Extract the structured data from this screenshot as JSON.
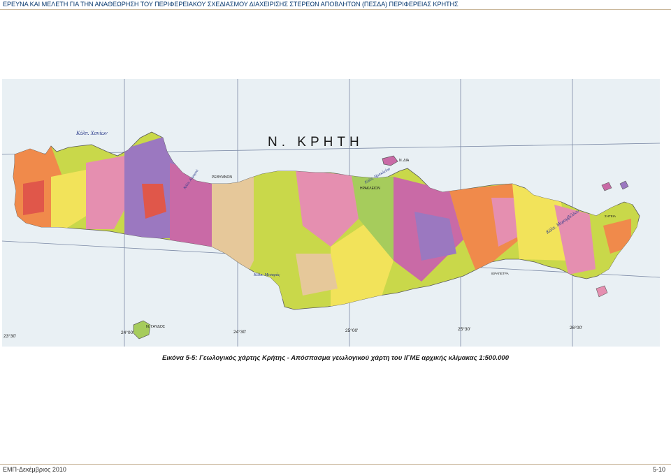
{
  "header": {
    "title": "ΕΡΕΥΝΑ ΚΑΙ ΜΕΛΕΤΗ ΓΙΑ ΤΗΝ ΑΝΑΘΕΩΡΗΣΗ ΤΟΥ ΠΕΡΙΦΕΡΕΙΑΚΟΥ ΣΧΕΔΙΑΣΜΟΥ ΔΙΑΧΕΙΡΙΣΗΣ ΣΤΕΡΕΩΝ ΑΠΟΒΛΗΤΩΝ (ΠΕΣΔΑ) ΠΕΡΙΦΕΡΕΙΑΣ ΚΡΗΤΗΣ"
  },
  "map": {
    "island_title": "Ν. ΚΡΗΤΗ",
    "longitude_labels": [
      "23°30'",
      "24°00'",
      "24°30'",
      "25°00'",
      "25°30'",
      "26°00'"
    ],
    "islands": [
      "Ν. ΓΑΥΔΟΣ",
      "Ν. ΔΙΑ"
    ],
    "gulfs": [
      "Κόλπ. Χανίων",
      "Κόλπ. Ηρακλείου",
      "Κόλπ. Μεσαράς",
      "Κόλπ. Μεραμβέλλου",
      "Κόλπ. Αλμυρού"
    ],
    "towns": [
      "ΡΕΘΥΜΝΟΝ",
      "ΗΡΑΚΛΕΙΟΝ",
      "ΙΕΡΑΠΕΤΡΑ",
      "ΣΗΤΕΙΑ"
    ],
    "colors": {
      "sea": "#e9f0f4",
      "grid": "#7c8aa6",
      "yellow_green": "#c9d84a",
      "yellow": "#f2e35a",
      "orange": "#f08a4b",
      "pink": "#e58fb0",
      "magenta": "#c96aa6",
      "violet": "#9b78c0",
      "beige": "#e6c89a",
      "lime": "#a6cc5c",
      "red": "#e0574a"
    }
  },
  "caption": "Εικόνα 5-5: Γεωλογικός χάρτης Κρήτης - Απόσπασμα γεωλογικού χάρτη του ΙΓΜΕ αρχικής κλίμακας 1:500.000",
  "footer": {
    "left": "ΕΜΠ-Δεκέμβριος 2010",
    "right": "5-10"
  }
}
